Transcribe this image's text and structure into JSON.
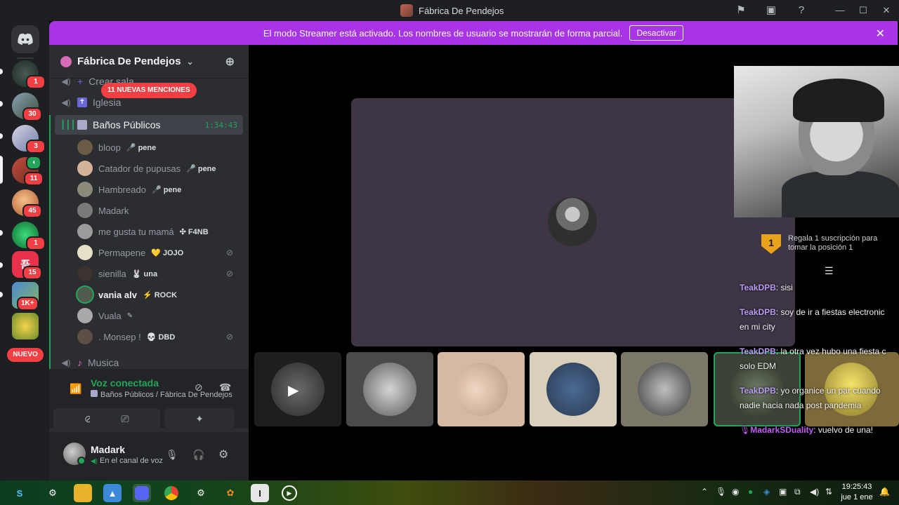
{
  "window": {
    "title": "Fábrica De Pendejos"
  },
  "banner": {
    "text": "El modo Streamer está activado. Los nombres de usuario se mostrarán de forma parcial.",
    "button": "Desactivar"
  },
  "servers": [
    {
      "name": "server-1",
      "badge": "1"
    },
    {
      "name": "server-2",
      "badge": "30"
    },
    {
      "name": "server-3",
      "badge": "3"
    },
    {
      "name": "server-4",
      "badge": "11"
    },
    {
      "name": "server-5",
      "badge": "45"
    },
    {
      "name": "server-6",
      "badge": "1"
    },
    {
      "name": "server-7",
      "badge": "15"
    },
    {
      "name": "server-8",
      "badge": "1K+"
    },
    {
      "name": "server-9",
      "badge": ""
    }
  ],
  "rail": {
    "nuevo": "NUEVO"
  },
  "guild": {
    "name": "Fábrica De Pendejos"
  },
  "mentions": "11 NUEVAS MENCIONES",
  "channels": {
    "crear": "Crear sala",
    "iglesia": "Iglesia",
    "banos": "Baños Públicos",
    "banos_timer": "1:34:43",
    "musica": "Musica"
  },
  "users": [
    {
      "name": "bloop",
      "tag": "🎤 pene",
      "muted": false
    },
    {
      "name": "Catador de pupusas",
      "tag": "🎤 pene",
      "muted": false
    },
    {
      "name": "Hambreado",
      "tag": "🎤 pene",
      "muted": false
    },
    {
      "name": "Madark",
      "tag": "",
      "muted": false
    },
    {
      "name": "me gusta tu mamá",
      "tag": "✣ F4NB",
      "muted": false
    },
    {
      "name": "Permapene",
      "tag": "💛 JOJO",
      "muted": true
    },
    {
      "name": "sienilla",
      "tag": "🐰 una",
      "muted": true
    },
    {
      "name": "vania alv",
      "tag": "⚡ ROCK",
      "muted": false
    },
    {
      "name": "Vuala",
      "tag": "",
      "muted": false
    },
    {
      "name": ". Monsep !",
      "tag": "💀 DBD",
      "muted": true
    }
  ],
  "voice": {
    "status": "Voz conectada",
    "channel": "Baños Públicos / Fábrica De Pendejos"
  },
  "me": {
    "name": "Madark",
    "status": "En el canal de voz"
  },
  "overlay": {
    "sub_goal_rank": "1",
    "sub_goal_text": "Regala 1 suscripción para tomar la posición 1"
  },
  "chat": [
    {
      "user": "TeakDPB",
      "text": ": sisi"
    },
    {
      "user": "TeakDPB",
      "text": ": soy de ir a fiestas electronic",
      "text2": "en mi city"
    },
    {
      "user": "TeakDPB",
      "text": ": la otra vez hubo una fiesta c",
      "text2": "solo EDM"
    },
    {
      "user": "TeakDPB",
      "text": ": yo organice un par cuando",
      "text2": "nadie hacia nada post pandemia"
    },
    {
      "user": "MadarkSDuality",
      "text": ": vuelvo de una!"
    }
  ],
  "taskbar": {
    "time": "19:25:43",
    "date": "jue 1 ene"
  },
  "colors": {
    "accent": "#a834e6",
    "voice_green": "#23a559",
    "badge_red": "#f23f43",
    "chat_user": "#b79cf2"
  }
}
